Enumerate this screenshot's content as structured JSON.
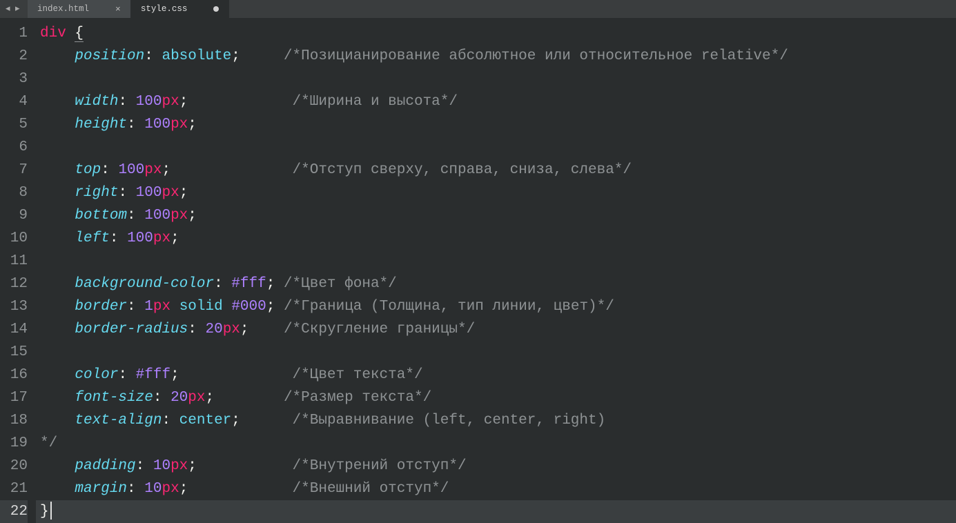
{
  "nav": {
    "back": "◂",
    "forward": "▸"
  },
  "tabs": [
    {
      "label": "index.html",
      "close": "×",
      "dirty": false,
      "active": false
    },
    {
      "label": "style.css",
      "close": "",
      "dirty": true,
      "active": true
    }
  ],
  "lineCount": 22,
  "code": {
    "selector": "div",
    "open": "{",
    "close": "}",
    "rules": [
      {
        "prop": "position",
        "colon": ": ",
        "num": "",
        "unit": "",
        "val": "absolute",
        "semi": ";",
        "pad": "     ",
        "comment": "/*Позицианирование абсолютное или относительное relative*/"
      },
      {
        "blank": true
      },
      {
        "prop": "width",
        "colon": ": ",
        "num": "100",
        "unit": "px",
        "val": "",
        "semi": ";",
        "pad": "            ",
        "comment": "/*Ширина и высота*/"
      },
      {
        "prop": "height",
        "colon": ": ",
        "num": "100",
        "unit": "px",
        "val": "",
        "semi": ";",
        "pad": "",
        "comment": ""
      },
      {
        "blank": true
      },
      {
        "prop": "top",
        "colon": ": ",
        "num": "100",
        "unit": "px",
        "val": "",
        "semi": ";",
        "pad": "              ",
        "comment": "/*Отступ сверху, справа, сниза, слева*/"
      },
      {
        "prop": "right",
        "colon": ": ",
        "num": "100",
        "unit": "px",
        "val": "",
        "semi": ";",
        "pad": "",
        "comment": ""
      },
      {
        "prop": "bottom",
        "colon": ": ",
        "num": "100",
        "unit": "px",
        "val": "",
        "semi": ";",
        "pad": "",
        "comment": ""
      },
      {
        "prop": "left",
        "colon": ": ",
        "num": "100",
        "unit": "px",
        "val": "",
        "semi": ";",
        "pad": "",
        "comment": ""
      },
      {
        "blank": true
      },
      {
        "prop": "background-color",
        "colon": ": ",
        "num": "",
        "unit": "",
        "val": "#fff",
        "hex": true,
        "semi": ";",
        "pad": " ",
        "comment": "/*Цвет фона*/"
      },
      {
        "prop": "border",
        "colon": ": ",
        "compound": [
          {
            "t": "num",
            "v": "1"
          },
          {
            "t": "unit",
            "v": "px"
          },
          {
            "t": "punc",
            "v": " "
          },
          {
            "t": "val",
            "v": "solid"
          },
          {
            "t": "punc",
            "v": " "
          },
          {
            "t": "hex",
            "v": "#000"
          }
        ],
        "semi": ";",
        "pad": " ",
        "comment": "/*Граница (Толщина, тип линии, цвет)*/"
      },
      {
        "prop": "border-radius",
        "colon": ": ",
        "num": "20",
        "unit": "px",
        "val": "",
        "semi": ";",
        "pad": "    ",
        "comment": "/*Скругление границы*/"
      },
      {
        "blank": true
      },
      {
        "prop": "color",
        "colon": ": ",
        "num": "",
        "unit": "",
        "val": "#fff",
        "hex": true,
        "semi": ";",
        "pad": "             ",
        "comment": "/*Цвет текста*/"
      },
      {
        "prop": "font-size",
        "colon": ": ",
        "num": "20",
        "unit": "px",
        "val": "",
        "semi": ";",
        "pad": "        ",
        "comment": "/*Размер текста*/"
      },
      {
        "prop": "text-align",
        "colon": ": ",
        "num": "",
        "unit": "",
        "val": "center",
        "semi": ";",
        "pad": "      ",
        "comment": "/*Выравнивание (left, center, right)"
      },
      {
        "commentOnly": "*/"
      },
      {
        "prop": "padding",
        "colon": ": ",
        "num": "10",
        "unit": "px",
        "val": "",
        "semi": ";",
        "pad": "           ",
        "comment": "/*Внутрений отступ*/"
      },
      {
        "prop": "margin",
        "colon": ": ",
        "num": "10",
        "unit": "px",
        "val": "",
        "semi": ";",
        "pad": "            ",
        "comment": "/*Внешний отступ*/"
      }
    ]
  }
}
